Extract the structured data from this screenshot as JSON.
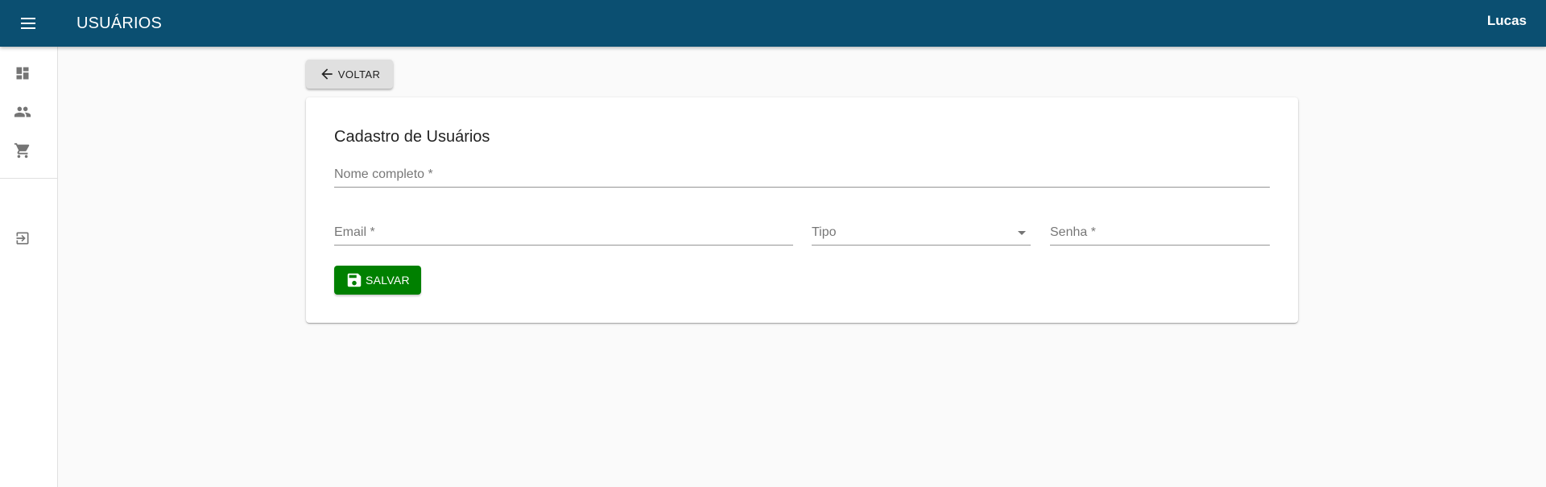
{
  "header": {
    "title": "USUÁRIOS",
    "user": "Lucas",
    "background": "#0b4f71"
  },
  "drawer": {
    "items": [
      {
        "icon": "dashboard-icon"
      },
      {
        "icon": "people-icon"
      },
      {
        "icon": "cart-icon"
      }
    ],
    "bottom_items": [
      {
        "icon": "logout-icon"
      }
    ]
  },
  "back_button": {
    "label": "VOLTAR",
    "icon": "arrow-back-icon"
  },
  "form": {
    "title": "Cadastro de Usuários",
    "name_label": "Nome completo *",
    "email_label": "Email *",
    "type_label": "Tipo",
    "password_label": "Senha *",
    "save_label": "SALVAR",
    "save_color": "#008000"
  }
}
